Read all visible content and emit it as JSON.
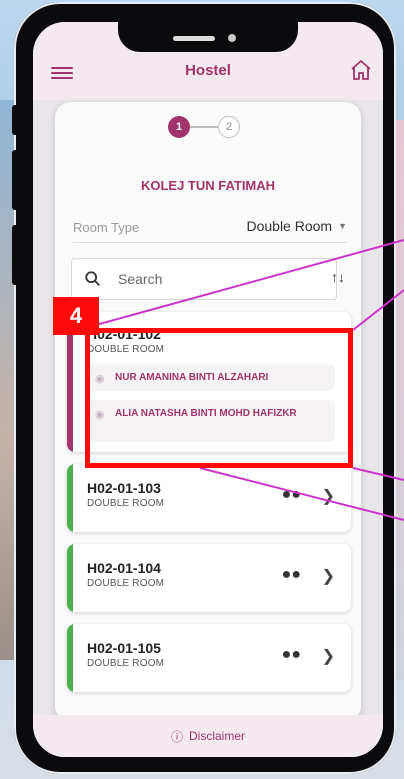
{
  "app": {
    "title": "Hostel"
  },
  "stepper": {
    "step1": "1",
    "step2": "2"
  },
  "college": "KOLEJ TUN FATIMAH",
  "filter": {
    "room_type_label": "Room Type",
    "room_type_value": "Double Room"
  },
  "search": {
    "placeholder": "Search"
  },
  "annotation": {
    "number": "4"
  },
  "rooms": [
    {
      "code": "H02-01-102",
      "type": "DOUBLE ROOM",
      "occupants": [
        "NUR AMANINA BINTI ALZAHARI",
        "ALIA NATASHA BINTI MOHD HAFIZKR"
      ]
    },
    {
      "code": "H02-01-103",
      "type": "DOUBLE ROOM"
    },
    {
      "code": "H02-01-104",
      "type": "DOUBLE ROOM"
    },
    {
      "code": "H02-01-105",
      "type": "DOUBLE ROOM"
    }
  ],
  "footer": {
    "disclaimer": "Disclaimer"
  },
  "colors": {
    "accent": "#a0346b",
    "available": "#4caf50",
    "highlight": "#ff0a0a"
  }
}
